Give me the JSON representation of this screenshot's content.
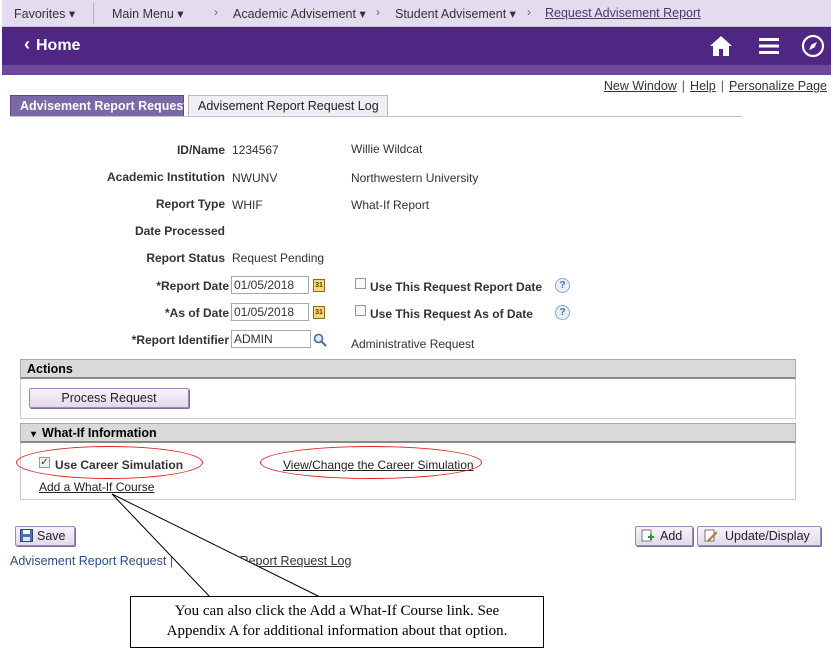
{
  "nav": {
    "favorites": "Favorites ▾",
    "main_menu": "Main Menu ▾",
    "academic_advisement": "Academic Advisement ▾",
    "student_advisement": "Student Advisement ▾",
    "current": "Request Advisement Report",
    "separator": "›"
  },
  "header": {
    "back_chevron": "‹",
    "home_label": "Home",
    "icons": [
      "home-icon",
      "menu-icon",
      "navbar-compass-icon"
    ],
    "bg_color": "#4f2683"
  },
  "page_links": {
    "new_window": "New Window",
    "help": "Help",
    "personalize": "Personalize Page",
    "divider": "|"
  },
  "tabs": [
    {
      "label": "Advisement Report Request",
      "active": true
    },
    {
      "label": "Advisement Report Request Log",
      "active": false
    }
  ],
  "form": {
    "id_name_label": "ID/Name",
    "id_value": "1234567",
    "name_value": "Willie Wildcat",
    "institution_label": "Academic Institution",
    "institution_code": "NWUNV",
    "institution_name": "Northwestern University",
    "report_type_label": "Report Type",
    "report_type_code": "WHIF",
    "report_type_name": "What-If Report",
    "date_processed_label": "Date Processed",
    "report_status_label": "Report Status",
    "report_status_value": "Request Pending",
    "report_date_label": "*Report Date",
    "report_date_value": "01/05/2018",
    "use_report_date_label": "Use This Request Report Date",
    "as_of_date_label": "*As of Date",
    "as_of_date_value": "01/05/2018",
    "use_as_of_date_label": "Use This Request As of Date",
    "report_identifier_label": "*Report Identifier",
    "report_identifier_value": "ADMIN",
    "report_identifier_desc": "Administrative Request",
    "calendar_glyph": "31",
    "help_glyph": "?"
  },
  "actions": {
    "title": "Actions",
    "process_request": "Process Request"
  },
  "what_if": {
    "title": "What-If Information",
    "collapse_glyph": "▾",
    "use_career_simulation": "Use Career Simulation",
    "use_career_simulation_checked": true,
    "view_change_link": "View/Change the Career Simulation",
    "add_course_link": "Add a What-If Course"
  },
  "toolbar": {
    "save": "Save",
    "add": "Add",
    "update_display": "Update/Display"
  },
  "bottom_links": {
    "first": "Advisement Report Request",
    "divider": "|",
    "second": "Report Request Log"
  },
  "callout": {
    "line1": "You can also click the Add a What-If Course link. See",
    "line2": "Appendix A for additional information about that option."
  },
  "colors": {
    "accent_purple": "#4f2683",
    "tab_active": "#7b68a6",
    "highlight_oval": "#e02020"
  }
}
